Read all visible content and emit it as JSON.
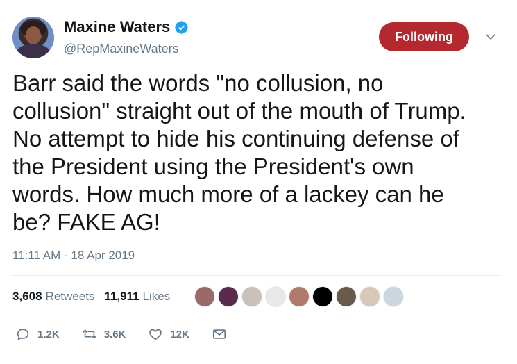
{
  "author": {
    "display_name": "Maxine Waters",
    "handle": "@RepMaxineWaters",
    "verified": true
  },
  "follow_button": {
    "label": "Following",
    "color": "#b3292f"
  },
  "tweet": {
    "text": "Barr said the words \"no collusion, no\ncollusion\" straight out of the mouth of Trump.\nNo attempt to hide his continuing defense of\nthe President using the President's own\nwords. How much more of a lackey can he\nbe? FAKE AG!",
    "timestamp": "11:11 AM - 18 Apr 2019"
  },
  "stats": {
    "retweets_count": "3,608",
    "retweets_label": "Retweets",
    "likes_count": "11,911",
    "likes_label": "Likes"
  },
  "liker_avatars": [
    {
      "color": "#9a6a6a"
    },
    {
      "color": "#5a2a4a"
    },
    {
      "color": "#c8c2b8"
    },
    {
      "color": "#e8e8e8"
    },
    {
      "color": "#b07a6a"
    },
    {
      "color": "#000000"
    },
    {
      "color": "#6a5a4a"
    },
    {
      "color": "#d8c8b8"
    },
    {
      "color": "#ccd6dd"
    }
  ],
  "actions": {
    "reply_count": "1.2K",
    "retweet_count": "3.6K",
    "like_count": "12K"
  },
  "icons": {
    "verified": "verified-badge-icon",
    "chevron": "chevron-down-icon",
    "reply": "reply-icon",
    "retweet": "retweet-icon",
    "like": "heart-icon",
    "dm": "envelope-icon"
  }
}
